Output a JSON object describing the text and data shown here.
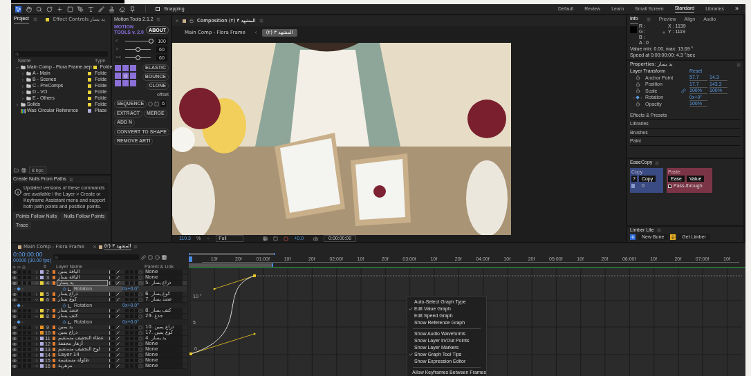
{
  "toolbar": {
    "snapping": {
      "label": "Snapping",
      "checked": false
    },
    "workspaces": [
      {
        "label": "Default",
        "selected": false
      },
      {
        "label": "Review",
        "selected": false
      },
      {
        "label": "Learn",
        "selected": false
      },
      {
        "label": "Small Screen",
        "selected": false
      },
      {
        "label": "Standard",
        "selected": true
      },
      {
        "label": "Libraries",
        "selected": false
      }
    ],
    "more": "»"
  },
  "project": {
    "tabs": [
      {
        "label": "Project",
        "selected": true
      },
      {
        "label": "Effect Controls يد يسار",
        "selected": false
      }
    ],
    "columns": [
      "Name",
      "Type"
    ],
    "items": [
      {
        "name": "Main Comp - Flora Frame.aep",
        "type": "Folde",
        "kind": "folder",
        "expanded": true,
        "color": "#e6d13a",
        "children": [
          {
            "name": "A - Main",
            "type": "Folde",
            "kind": "folder",
            "expanded": false,
            "color": "#e6d13a"
          },
          {
            "name": "B - Scenes",
            "type": "Folde",
            "kind": "folder",
            "expanded": false,
            "color": "#e6d13a"
          },
          {
            "name": "C - PreComps",
            "type": "Folde",
            "kind": "folder",
            "expanded": false,
            "color": "#e6d13a"
          },
          {
            "name": "D - VO",
            "type": "Folde",
            "kind": "folder",
            "expanded": false,
            "color": "#e6d13a"
          },
          {
            "name": "E - Others",
            "type": "Folde",
            "kind": "folder",
            "expanded": false,
            "color": "#e6d13a"
          }
        ]
      },
      {
        "name": "Solids",
        "type": "Folde",
        "kind": "folder",
        "expanded": false,
        "color": "#e6d13a"
      },
      {
        "name": "Was Circular Reference",
        "type": "Place",
        "kind": "placeholder",
        "color": "#b0aee0"
      }
    ],
    "bpc": "8 bpc"
  },
  "create_nulls": {
    "title": "Create Nulls From Paths",
    "message": "Updated versions of these commands are available i the Layer > Create or Keyframe Assistant menu and support both path points and position points.",
    "buttons": [
      "Points Follow Nulls",
      "Nulls Follow Points",
      "Trace"
    ]
  },
  "motion_tools": {
    "title": "Motion Tools 2.1.2",
    "logo": "MOTION TOOLS v. 2.0",
    "about": "ABOUT",
    "sliders": [
      {
        "label": "<",
        "level": 1,
        "value": "100"
      },
      {
        "label": ">",
        "level": 0.5,
        "value": "60"
      },
      {
        "label": "><",
        "level": 0.5,
        "value": "60"
      }
    ],
    "effects": [
      "ELASTIC",
      "BOUNCE",
      "CLONE"
    ],
    "offset": "offset",
    "sequence": "SEQUENCE",
    "count": "6",
    "actions": [
      "EXTRACT",
      "MERGE",
      "ADD N"
    ],
    "actions2": [
      "CONVERT TO SHAPE",
      "REMOVE ARTI"
    ]
  },
  "composition": {
    "tab": "Composition (٢) المشهد ٣",
    "breadcrumbs": [
      {
        "label": "Main Comp - Flora Frame",
        "selected": false
      },
      {
        "label": "المشهد ٣ (٢)",
        "selected": true
      }
    ],
    "zoom": "110.3",
    "zoom_unit": "%",
    "resolution": "Full",
    "exposure": "+0.0",
    "time": "0:00:00:00"
  },
  "info": {
    "tabs": [
      {
        "label": "Info",
        "selected": true
      },
      {
        "label": "Preview",
        "selected": false
      },
      {
        "label": "Align",
        "selected": false
      },
      {
        "label": "Audio",
        "selected": false
      }
    ],
    "channels": [
      "R :",
      "G :",
      "B :",
      "A : 0"
    ],
    "x": "X : 1139",
    "y": "Y : 1119",
    "lines": [
      "Value min: 0.00, max: 13.69 °",
      "Speed at 0:00:00:00: 4.3 °/sec"
    ]
  },
  "properties": {
    "title": "Properties: يد يسار",
    "group": "Layer Transform",
    "reset": "Reset",
    "rows": [
      {
        "label": "Anchor Point",
        "kind": "stopwatch",
        "linked": false,
        "values": [
          "57.7",
          "14.3"
        ]
      },
      {
        "label": "Position",
        "kind": "stopwatch",
        "linked": false,
        "values": [
          "17.7",
          "143.3"
        ]
      },
      {
        "label": "Scale",
        "kind": "stopwatch",
        "linked": true,
        "values": [
          "100%",
          "100%"
        ]
      },
      {
        "label": "Rotation",
        "kind": "keyframe",
        "linked": false,
        "values": [
          "0x+0°"
        ]
      },
      {
        "label": "Opacity",
        "kind": "stopwatch",
        "linked": false,
        "values": [
          "100%"
        ]
      }
    ],
    "sections": [
      "Effects & Presets",
      "Libraries",
      "Brushes",
      "Paint"
    ]
  },
  "easecopy": {
    "title": "EaseCopy",
    "copy": {
      "title": "Copy",
      "help": "?",
      "button": "Copy",
      "count": "0"
    },
    "paste": {
      "title": "Paste",
      "buttons": [
        "Ease",
        "Value"
      ],
      "pass_through": {
        "label": "Pass-through",
        "checked": false
      }
    }
  },
  "limber": {
    "title": "Limber Lite",
    "buttons": [
      "New Bone",
      "Get Limber"
    ]
  },
  "timeline": {
    "tabs": [
      {
        "label": "Main Comp - Flora Frame",
        "selected": false
      },
      {
        "label": "المشهد ٣ (٢)",
        "selected": true
      }
    ],
    "time": "0:00:00:00",
    "frame": "00000 (30.00 fps)",
    "columns": {
      "number": "#",
      "name": "Layer Name",
      "parent": "Parent & Link"
    },
    "rows": [
      {
        "kind": "layer",
        "number": "2",
        "name": "الياقة يمين",
        "color": "#b0aee0",
        "expanded": false,
        "selected": false,
        "parent": "None"
      },
      {
        "kind": "layer",
        "number": "3",
        "name": "الياقة يسار",
        "color": "#b0aee0",
        "expanded": false,
        "selected": false,
        "parent": "None"
      },
      {
        "kind": "layer",
        "number": "4",
        "name": "يد يسار",
        "color": "#e6d13a",
        "expanded": true,
        "selected": true,
        "parent": "5. ذراع يسار"
      },
      {
        "kind": "property",
        "name": "Rotation",
        "value": "0x+0.0°",
        "selected": true
      },
      {
        "kind": "layer",
        "number": "5",
        "name": "ذراع يسار",
        "color": "#e6d13a",
        "expanded": false,
        "selected": false,
        "parent": "6. كوع يسار"
      },
      {
        "kind": "layer",
        "number": "6",
        "name": "كوع يسار",
        "color": "#e6d13a",
        "expanded": true,
        "selected": false,
        "parent": "7. عضد يسار"
      },
      {
        "kind": "property",
        "name": "Rotation",
        "value": "0x+0.0°",
        "selected": false
      },
      {
        "kind": "layer",
        "number": "7",
        "name": "عضد يسار",
        "color": "#e6d13a",
        "expanded": false,
        "selected": false,
        "parent": "8. كتف يسار"
      },
      {
        "kind": "layer",
        "number": "8",
        "name": "كتف يسار",
        "color": "#e6d13a",
        "expanded": true,
        "selected": false,
        "parent": "29. جذع"
      },
      {
        "kind": "property",
        "name": "Rotation",
        "value": "0x+0.0°",
        "selected": false
      },
      {
        "kind": "layer",
        "number": "9",
        "name": "يد يمين",
        "color": "#e8901e",
        "expanded": false,
        "selected": false,
        "parent": "10. ذراع يمين"
      },
      {
        "kind": "layer",
        "number": "10",
        "name": "ذراع يمين",
        "color": "#e8901e",
        "expanded": false,
        "selected": false,
        "parent": "17. كوع يمين"
      },
      {
        "kind": "layer",
        "number": "11",
        "name": "غطاء التجفيف مستقيم",
        "color": "#b0aee0",
        "expanded": false,
        "selected": false,
        "parent": "4. يد يسار"
      },
      {
        "kind": "layer",
        "number": "12",
        "name": "أزهار مجففة",
        "color": "#b0aee0",
        "expanded": false,
        "selected": false,
        "parent": "None"
      },
      {
        "kind": "layer",
        "number": "13",
        "name": "لوح التجفيف مستقيم",
        "color": "#b0aee0",
        "expanded": false,
        "selected": false,
        "parent": "None"
      },
      {
        "kind": "layer",
        "number": "14",
        "name": "Layer 14",
        "color": "#b0aee0",
        "expanded": false,
        "selected": false,
        "parent": "None"
      },
      {
        "kind": "layer",
        "number": "15",
        "name": "طاولة مستقيمة",
        "color": "#b0aee0",
        "expanded": false,
        "selected": false,
        "parent": "None"
      },
      {
        "kind": "layer",
        "number": "16",
        "name": "مزهرية",
        "color": "#b0aee0",
        "expanded": true,
        "selected": false,
        "parent": "None"
      }
    ],
    "ruler": [
      "10f",
      "20f",
      "01:00f",
      "10f",
      "20f",
      "02:00f",
      "10f",
      "20f",
      "03:00f",
      "10f",
      "20f",
      "04:00f",
      "10f",
      "20f",
      "05:00f",
      "10f",
      "20f",
      "06:00f",
      "10f",
      "20f",
      "07:00f",
      "10f"
    ],
    "graph_labels": [
      "10 °",
      "5",
      "0"
    ],
    "context_menu": [
      [
        {
          "label": "Auto-Select Graph Type",
          "checked": false
        },
        {
          "label": "Edit Value Graph",
          "checked": true
        },
        {
          "label": "Edit Speed Graph",
          "checked": false
        },
        {
          "label": "Show Reference Graph",
          "checked": false
        }
      ],
      [
        {
          "label": "Show Audio Waveforms",
          "checked": false
        },
        {
          "label": "Show Layer In/Out Points",
          "checked": false
        },
        {
          "label": "Show Layer Markers",
          "checked": false
        },
        {
          "label": "Show Graph Tool Tips",
          "checked": true
        },
        {
          "label": "Show Expression Editor",
          "checked": false
        }
      ],
      [
        {
          "label": "Allow Keyframes Between Frames",
          "checked": false
        }
      ]
    ]
  }
}
